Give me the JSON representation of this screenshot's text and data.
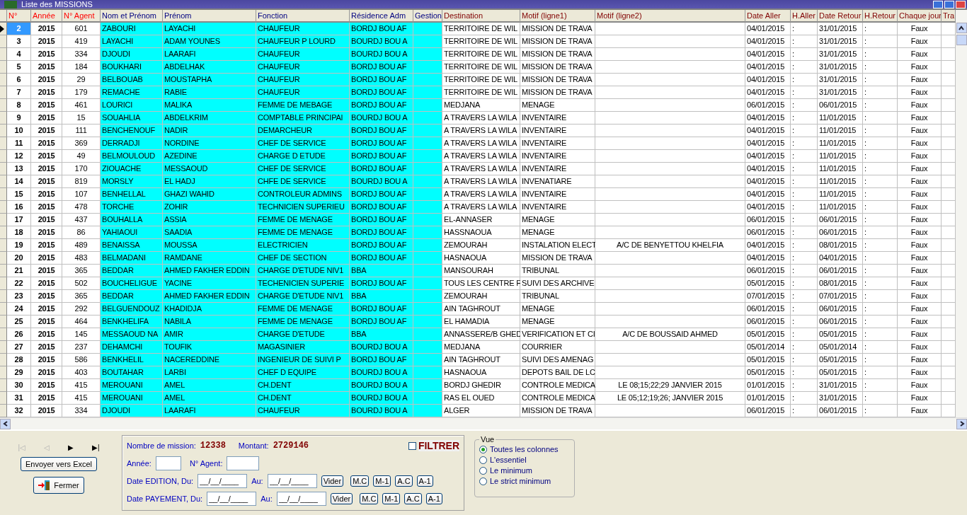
{
  "window": {
    "title": "Liste des MISSIONS"
  },
  "table": {
    "columns": [
      {
        "label": "N°"
      },
      {
        "label": "Année"
      },
      {
        "label": "N° Agent"
      },
      {
        "label": "Nom et Prénom"
      },
      {
        "label": "Prénom"
      },
      {
        "label": "Fonction"
      },
      {
        "label": "Résidence Adm"
      },
      {
        "label": "Gestion"
      },
      {
        "label": "Destination"
      },
      {
        "label": "Motif (ligne1)"
      },
      {
        "label": "Motif (ligne2)"
      },
      {
        "label": "Date Aller"
      },
      {
        "label": "H.Aller"
      },
      {
        "label": "Date Retour"
      },
      {
        "label": "H.Retour"
      },
      {
        "label": "Chaque jour"
      },
      {
        "label": "Tra"
      }
    ],
    "rows": [
      {
        "selected": true,
        "cells": [
          "2",
          "2015",
          "601",
          "ZABOURI",
          "LAYACHI",
          "CHAUFEUR",
          "BORDJ BOU AF",
          null,
          "TERRITOIRE DE WIL",
          "MISSION DE TRAVA",
          null,
          "04/01/2015",
          ":",
          "31/01/2015",
          ":",
          "Faux",
          null
        ]
      },
      {
        "selected": false,
        "cells": [
          "3",
          "2015",
          "419",
          "LAYACHI",
          "ADAM YOUNES",
          "CHAUFEUR P LOURD",
          "BOURDJ BOU A",
          null,
          "TERRITOIRE DE WIL",
          "MISSION DE TRAVA",
          null,
          "04/01/2015",
          ":",
          "31/01/2015",
          ":",
          "Faux",
          null
        ]
      },
      {
        "selected": false,
        "cells": [
          "4",
          "2015",
          "334",
          "DJOUDI",
          "LAARAFI",
          "CHAUFEUR",
          "BOURDJ BOU A",
          null,
          "TERRITOIRE DE WIL",
          "MISSION DE TRAVA",
          null,
          "04/01/2015",
          ":",
          "31/01/2015",
          ":",
          "Faux",
          null
        ]
      },
      {
        "selected": false,
        "cells": [
          "5",
          "2015",
          "184",
          "BOUKHARI",
          "ABDELHAK",
          "CHAUFEUR",
          "BORDJ BOU AF",
          null,
          "TERRITOIRE DE WIL",
          "MISSION DE TRAVA",
          null,
          "04/01/2015",
          ":",
          "31/01/2015",
          ":",
          "Faux",
          null
        ]
      },
      {
        "selected": false,
        "cells": [
          "6",
          "2015",
          "29",
          "BELBOUAB",
          "MOUSTAPHA",
          "CHAUFEUR",
          "BORDJ BOU AF",
          null,
          "TERRITOIRE DE WIL",
          "MISSION DE TRAVA",
          null,
          "04/01/2015",
          ":",
          "31/01/2015",
          ":",
          "Faux",
          null
        ]
      },
      {
        "selected": false,
        "cells": [
          "7",
          "2015",
          "179",
          "REMACHE",
          "RABIE",
          "CHAUFEUR",
          "BORDJ BOU AF",
          null,
          "TERRITOIRE DE WIL",
          "MISSION DE TRAVA",
          null,
          "04/01/2015",
          ":",
          "31/01/2015",
          ":",
          "Faux",
          null
        ]
      },
      {
        "selected": false,
        "cells": [
          "8",
          "2015",
          "461",
          "LOURICI",
          "MALIKA",
          "FEMME DE MEBAGE",
          "BORDJ BOU AF",
          null,
          "MEDJANA",
          "MENAGE",
          null,
          "06/01/2015",
          ":",
          "06/01/2015",
          ":",
          "Faux",
          null
        ]
      },
      {
        "selected": false,
        "cells": [
          "9",
          "2015",
          "15",
          "SOUAHLIA",
          "ABDELKRIM",
          "COMPTABLE PRINCIPAl",
          "BOURDJ BOU A",
          null,
          "A TRAVERS LA WILA",
          "INVENTAIRE",
          null,
          "04/01/2015",
          ":",
          "11/01/2015",
          ":",
          "Faux",
          null
        ]
      },
      {
        "selected": false,
        "cells": [
          "10",
          "2015",
          "111",
          "BENCHENOUF",
          "NADIR",
          "DEMARCHEUR",
          "BORDJ BOU AF",
          null,
          "A TRAVERS LA WILA",
          "INVENTAIRE",
          null,
          "04/01/2015",
          ":",
          "11/01/2015",
          ":",
          "Faux",
          null
        ]
      },
      {
        "selected": false,
        "cells": [
          "11",
          "2015",
          "369",
          "DERRADJI",
          "NORDINE",
          "CHEF DE SERVICE",
          "BORDJ BOU AF",
          null,
          "A TRAVERS LA WILA",
          "INVENTAIRE",
          null,
          "04/01/2015",
          ":",
          "11/01/2015",
          ":",
          "Faux",
          null
        ]
      },
      {
        "selected": false,
        "cells": [
          "12",
          "2015",
          "49",
          "BELMOULOUD",
          "AZEDINE",
          "CHARGE D ETUDE",
          "BORDJ BOU AF",
          null,
          "A TRAVERS LA WILA",
          "INVENTAIRE",
          null,
          "04/01/2015",
          ":",
          "11/01/2015",
          ":",
          "Faux",
          null
        ]
      },
      {
        "selected": false,
        "cells": [
          "13",
          "2015",
          "170",
          "ZIOUACHE",
          "MESSAOUD",
          "CHEF DE SERVICE",
          "BORDJ BOU AF",
          null,
          "A TRAVERS LA WILA",
          "INVENTAIRE",
          null,
          "04/01/2015",
          ":",
          "11/01/2015",
          ":",
          "Faux",
          null
        ]
      },
      {
        "selected": false,
        "cells": [
          "14",
          "2015",
          "819",
          "MORSLY",
          "EL HADJ",
          "CHFE DE SERVICE",
          "BOURDJ BOU A",
          null,
          "A TRAVERS LA WILA",
          "INVENATIARE",
          null,
          "04/01/2015",
          ":",
          "11/01/2015",
          ":",
          "Faux",
          null
        ]
      },
      {
        "selected": false,
        "cells": [
          "15",
          "2015",
          "107",
          "BENHELLAL",
          "GHAZI WAHID",
          "CONTROLEUR ADMINS",
          "BORDJ BOU AF",
          null,
          "A TRAVERS LA WILA",
          "INVENTAIRE",
          null,
          "04/01/2015",
          ":",
          "11/01/2015",
          ":",
          "Faux",
          null
        ]
      },
      {
        "selected": false,
        "cells": [
          "16",
          "2015",
          "478",
          "TORCHE",
          "ZOHIR",
          "TECHNICIEN SUPERIEU",
          "BORDJ BOU AF",
          null,
          "A TRAVERS LA WILA",
          "INVENTAIRE",
          null,
          "04/01/2015",
          ":",
          "11/01/2015",
          ":",
          "Faux",
          null
        ]
      },
      {
        "selected": false,
        "cells": [
          "17",
          "2015",
          "437",
          "BOUHALLA",
          "ASSIA",
          "FEMME DE MENAGE",
          "BORDJ BOU AF",
          null,
          "EL-ANNASER",
          "MENAGE",
          null,
          "06/01/2015",
          ":",
          "06/01/2015",
          ":",
          "Faux",
          null
        ]
      },
      {
        "selected": false,
        "cells": [
          "18",
          "2015",
          "86",
          "YAHIAOUI",
          "SAADIA",
          "FEMME DE MENAGE",
          "BORDJ BOU AF",
          null,
          "HASSNAOUA",
          "MENAGE",
          null,
          "06/01/2015",
          ":",
          "06/01/2015",
          ":",
          "Faux",
          null
        ]
      },
      {
        "selected": false,
        "cells": [
          "19",
          "2015",
          "489",
          "BENAISSA",
          "MOUSSA",
          "ELECTRICIEN",
          "BORDJ BOU AF",
          null,
          "ZEMOURAH",
          "INSTALATION ELECT",
          "A/C DE BENYETTOU KHELFIA",
          "04/01/2015",
          ":",
          "08/01/2015",
          ":",
          "Faux",
          null
        ]
      },
      {
        "selected": false,
        "cells": [
          "20",
          "2015",
          "483",
          "BELMADANI",
          "RAMDANE",
          "CHEF DE SECTION",
          "BORDJ BOU AF",
          null,
          "HASNAOUA",
          "MISSION DE TRAVA",
          null,
          "04/01/2015",
          ":",
          "04/01/2015",
          ":",
          "Faux",
          null
        ]
      },
      {
        "selected": false,
        "cells": [
          "21",
          "2015",
          "365",
          "BEDDAR",
          "AHMED FAKHER EDDIN",
          "CHARGE D'ETUDE NIV1",
          "BBA",
          null,
          "MANSOURAH",
          "TRIBUNAL",
          null,
          "06/01/2015",
          ":",
          "06/01/2015",
          ":",
          "Faux",
          null
        ]
      },
      {
        "selected": false,
        "cells": [
          "22",
          "2015",
          "502",
          "BOUCHELIGUE",
          "YACINE",
          "TECHENICIEN SUPERIE",
          "BORDJ BOU AF",
          null,
          "TOUS LES CENTRE F",
          "SUIVI DES ARCHIVE",
          null,
          "05/01/2015",
          ":",
          "08/01/2015",
          ":",
          "Faux",
          null
        ]
      },
      {
        "selected": false,
        "cells": [
          "23",
          "2015",
          "365",
          "BEDDAR",
          "AHMED FAKHER EDDIN",
          "CHARGE D'ETUDE NIV1",
          "BBA",
          null,
          "ZEMOURAH",
          "TRIBUNAL",
          null,
          "07/01/2015",
          ":",
          "07/01/2015",
          ":",
          "Faux",
          null
        ]
      },
      {
        "selected": false,
        "cells": [
          "24",
          "2015",
          "292",
          "BELGUENDOUZ",
          "KHADIDJA",
          "FEMME DE MENAGE",
          "BORDJ BOU AF",
          null,
          "AIN TAGHROUT",
          "MENAGE",
          null,
          "06/01/2015",
          ":",
          "06/01/2015",
          ":",
          "Faux",
          null
        ]
      },
      {
        "selected": false,
        "cells": [
          "25",
          "2015",
          "464",
          "BENKHELIFA",
          "NABILA",
          "FEMME DE MENAGE",
          "BORDJ BOU AF",
          null,
          "EL HAMADIA",
          "MENAGE",
          null,
          "06/01/2015",
          ":",
          "06/01/2015",
          ":",
          "Faux",
          null
        ]
      },
      {
        "selected": false,
        "cells": [
          "26",
          "2015",
          "145",
          "MESSAOUD NA",
          "AMIR",
          "CHARGE D'ETUDE",
          "BBA",
          null,
          "ANNASSERE/B GHED",
          "VERIFICATION ET CI",
          "A/C DE BOUSSAID AHMED",
          "05/01/2015",
          ":",
          "05/01/2015",
          ":",
          "Faux",
          null
        ]
      },
      {
        "selected": false,
        "cells": [
          "27",
          "2015",
          "237",
          "DEHAMCHI",
          "TOUFIK",
          "MAGASINIER",
          "BOURDJ BOU A",
          null,
          "MEDJANA",
          "COURRIER",
          null,
          "05/01/2014",
          ":",
          "05/01/2014",
          ":",
          "Faux",
          null
        ]
      },
      {
        "selected": false,
        "cells": [
          "28",
          "2015",
          "586",
          "BENKHELIL",
          "NACEREDDINE",
          "INGENIEUR DE SUIVI P",
          "BORDJ BOU AF",
          null,
          "AIN TAGHROUT",
          "SUIVI DES AMENAG",
          null,
          "05/01/2015",
          ":",
          "05/01/2015",
          ":",
          "Faux",
          null
        ]
      },
      {
        "selected": false,
        "cells": [
          "29",
          "2015",
          "403",
          "BOUTAHAR",
          "LARBI",
          "CHEF D EQUIPE",
          "BOURDJ BOU A",
          null,
          "HASNAOUA",
          "DEPOTS BAIL DE LC",
          null,
          "05/01/2015",
          ":",
          "05/01/2015",
          ":",
          "Faux",
          null
        ]
      },
      {
        "selected": false,
        "cells": [
          "30",
          "2015",
          "415",
          "MEROUANI",
          "AMEL",
          "CH.DENT",
          "BOURDJ BOU A",
          null,
          "BORDJ GHEDIR",
          "CONTROLE MEDICA",
          "LE 08;15;22;29 JANVIER 2015",
          "01/01/2015",
          ":",
          "31/01/2015",
          ":",
          "Faux",
          null
        ]
      },
      {
        "selected": false,
        "cells": [
          "31",
          "2015",
          "415",
          "MEROUANI",
          "AMEL",
          "CH.DENT",
          "BOURDJ BOU A",
          null,
          "RAS EL OUED",
          "CONTROLE MEDICA",
          "LE 05;12;19;26; JANVIER 2015",
          "01/01/2015",
          ":",
          "31/01/2015",
          ":",
          "Faux",
          null
        ]
      },
      {
        "selected": false,
        "cells": [
          "32",
          "2015",
          "334",
          "DJOUDI",
          "LAARAFI",
          "CHAUFEUR",
          "BOURDJ BOU A",
          null,
          "ALGER",
          "MISSION DE TRAVA",
          null,
          "06/01/2015",
          ":",
          "06/01/2015",
          ":",
          "Faux",
          null
        ]
      }
    ]
  },
  "navigator": [
    {
      "symbol": "|◁",
      "disabled": true
    },
    {
      "symbol": "◁",
      "disabled": true
    },
    {
      "symbol": "▶",
      "disabled": false
    },
    {
      "symbol": "▶|",
      "disabled": false
    }
  ],
  "buttons": {
    "excel": "Envoyer vers Excel",
    "close": "Fermer"
  },
  "filter": {
    "count_label": "Nombre de mission:",
    "count": "12338",
    "amount_label": "Montant:",
    "amount": "2729146",
    "filter_label": "FILTRER",
    "filter_checked": false,
    "year_label": "Année:",
    "agent_label": "N° Agent:",
    "date_rows": [
      {
        "label": "Date EDITION, Du:",
        "from": "__/__/____",
        "to_label": "Au:",
        "to": "__/__/____",
        "buttons": [
          "Vider",
          "M.C",
          "M-1",
          "A.C",
          "A-1"
        ]
      },
      {
        "label": "Date PAYEMENT, Du:",
        "from": "__/__/____",
        "to_label": "Au:",
        "to": "__/__/____",
        "buttons": [
          "Vider",
          "M.C",
          "M-1",
          "A.C",
          "A-1"
        ]
      }
    ]
  },
  "view": {
    "title": "Vue",
    "options": [
      {
        "label": "Toutes les colonnes",
        "selected": true
      },
      {
        "label": "L'essentiel",
        "selected": false
      },
      {
        "label": "Le minimum",
        "selected": false
      },
      {
        "label": "Le strict minimum",
        "selected": false
      }
    ]
  }
}
